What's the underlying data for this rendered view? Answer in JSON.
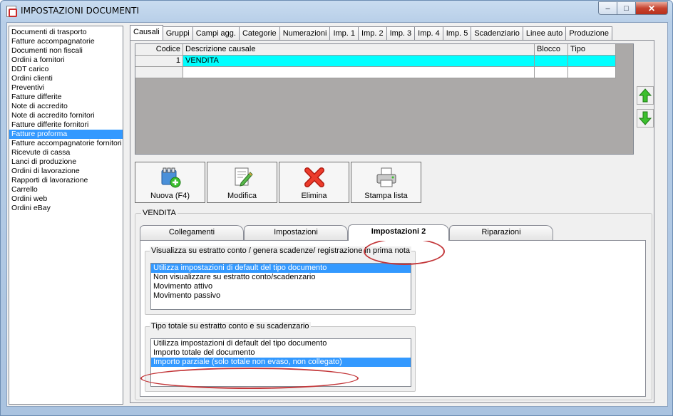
{
  "window": {
    "title": "IMPOSTAZIONI DOCUMENTI",
    "btn_min": "–",
    "btn_max": "□",
    "btn_close": "✕"
  },
  "doc_list": [
    "Documenti di trasporto",
    "Fatture accompagnatorie",
    "Documenti non fiscali",
    "Ordini a fornitori",
    "DDT carico",
    "Ordini clienti",
    "Preventivi",
    "Fatture differite",
    "Note di accredito",
    "Note di accredito fornitori",
    "Fatture differite fornitori",
    "Fatture proforma",
    "Fatture accompagnatorie fornitori",
    "Ricevute di cassa",
    "Lanci di produzione",
    "Ordini di lavorazione",
    "Rapporti di lavorazione",
    "Carrello",
    "Ordini web",
    "Ordini eBay"
  ],
  "doc_list_selected": "Fatture proforma",
  "tabs": [
    "Causali",
    "Gruppi",
    "Campi agg.",
    "Categorie",
    "Numerazioni",
    "Imp. 1",
    "Imp. 2",
    "Imp. 3",
    "Imp. 4",
    "Imp. 5",
    "Scadenziario",
    "Linee auto",
    "Produzione"
  ],
  "active_tab": "Causali",
  "grid": {
    "headers": {
      "codice": "Codice",
      "descrizione": "Descrizione causale",
      "blocco": "Blocco",
      "tipo": "Tipo"
    },
    "rows": [
      {
        "codice": "1",
        "descrizione": "VENDITA",
        "blocco": "",
        "tipo": ""
      }
    ]
  },
  "arrows": {
    "up": "move-up",
    "down": "move-down"
  },
  "toolbar": {
    "nuova": "Nuova (F4)",
    "modifica": "Modifica",
    "elimina": "Elimina",
    "stampa": "Stampa lista"
  },
  "detail": {
    "group_title": "VENDITA",
    "subtabs": [
      "Collegamenti",
      "Impostazioni",
      "Impostazioni 2",
      "Riparazioni"
    ],
    "active_subtab": "Impostazioni 2",
    "estratto": {
      "legend": "Visualizza su estratto conto / genera scadenze/ registrazione  in prima nota",
      "options": [
        "Utilizza impostazioni di default del tipo documento",
        "Non visualizzare su estratto conto/scadenzario",
        "Movimento attivo",
        "Movimento passivo"
      ],
      "selected": "Utilizza impostazioni di default del tipo documento"
    },
    "tipo_totale": {
      "legend": "Tipo totale su estratto conto e su scadenzario",
      "options": [
        "Utilizza impostazioni di default del tipo documento",
        "Importo totale del documento",
        "Importo parziale (solo totale non evaso, non collegato)"
      ],
      "selected": "Importo parziale (solo totale non evaso, non collegato)"
    }
  },
  "colors": {
    "selection": "#3399ff",
    "grid_row": "#00ffff",
    "annotation": "#c3373a"
  }
}
